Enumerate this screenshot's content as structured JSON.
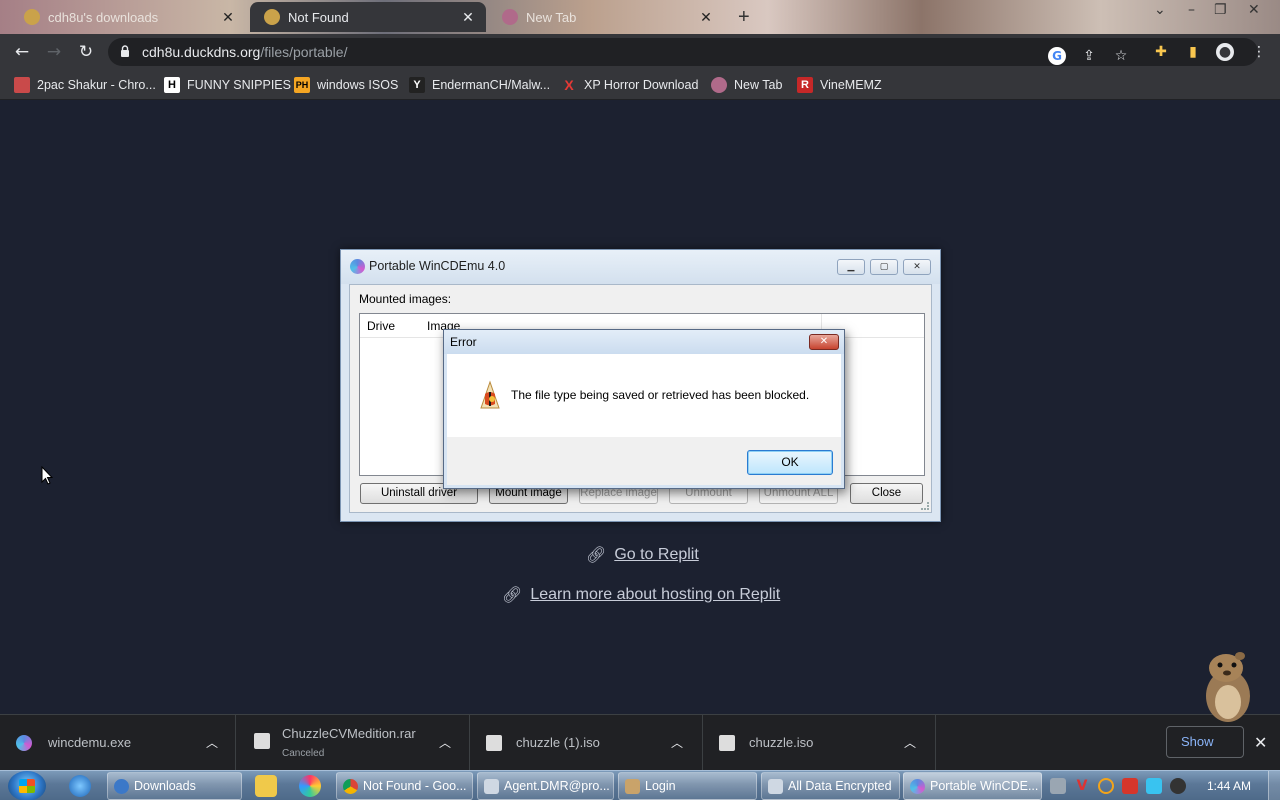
{
  "browser": {
    "tabs": [
      {
        "title": "cdh8u's downloads",
        "active": false
      },
      {
        "title": "Not Found",
        "active": true
      },
      {
        "title": "New Tab",
        "active": false
      }
    ],
    "url_host": "cdh8u.duckdns.org",
    "url_path": "/files/portable/",
    "bookmarks": [
      {
        "label": "2pac Shakur - Chro...",
        "icon": "2pac-favicon"
      },
      {
        "label": "FUNNY SNIPPIES",
        "icon": "H"
      },
      {
        "label": "windows ISOS",
        "icon": "PH"
      },
      {
        "label": "EndermanCH/Malw...",
        "icon": "Y"
      },
      {
        "label": "XP Horror Download",
        "icon": "X"
      },
      {
        "label": "New Tab",
        "icon": "new-tab-favicon"
      },
      {
        "label": "VineMEMZ",
        "icon": "R"
      }
    ]
  },
  "page": {
    "link1": "Go to Replit",
    "link2": "Learn more about hosting on Replit"
  },
  "wincdemu": {
    "title": "Portable WinCDEmu 4.0",
    "mounted_label": "Mounted images:",
    "columns": [
      "Drive",
      "Image"
    ],
    "buttons": {
      "uninstall": "Uninstall driver",
      "mount": "Mount image",
      "replace": "Replace image",
      "unmount": "Unmount",
      "unmount_all": "Unmount ALL",
      "close": "Close"
    }
  },
  "error_dialog": {
    "title": "Error",
    "message": "The file type being saved or retrieved has been blocked.",
    "ok": "OK",
    "icon": "warning-shield-icon"
  },
  "downloads": [
    {
      "name": "wincdemu.exe",
      "status": ""
    },
    {
      "name": "ChuzzleCVMedition.rar",
      "status": "Canceled"
    },
    {
      "name": "chuzzle (1).iso",
      "status": ""
    },
    {
      "name": "chuzzle.iso",
      "status": ""
    }
  ],
  "downloads_show_all": "Show",
  "taskbar": {
    "items": [
      {
        "label": "Downloads"
      },
      {
        "label": "Not Found - Goo..."
      },
      {
        "label": "Agent.DMR@pro..."
      },
      {
        "label": "Login"
      },
      {
        "label": "All Data Encrypted"
      },
      {
        "label": "Portable WinCDE..."
      }
    ],
    "clock": "1:44 AM"
  },
  "colors": {
    "page_bg": "#1c2130",
    "chrome_toolbar": "#35363a",
    "link": "#c7ccd8"
  }
}
